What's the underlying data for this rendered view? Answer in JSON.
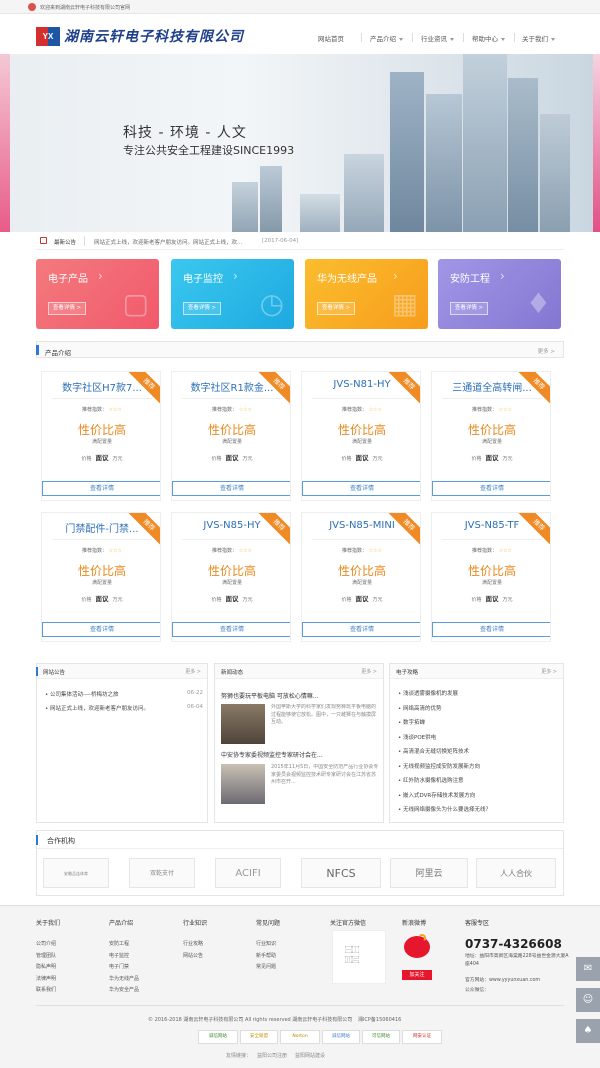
{
  "top_bar": {
    "welcome": "欢迎来到湖南云轩电子科技有限公司官网"
  },
  "logo": {
    "mark": "YX",
    "company": "湖南云轩电子科技有限公司"
  },
  "nav": [
    "网站首页",
    "产品介绍",
    "行业资讯",
    "帮助中心",
    "关于我们"
  ],
  "hero": {
    "line1": "科技 - 环境 - 人文",
    "line2": "专注公共安全工程建设SINCE1993"
  },
  "notice": {
    "label": "最新公告",
    "text": "网站正式上线，欢迎新老客户朋友访问。网站正式上线，欢...",
    "date": "[2017-06-04]"
  },
  "categories": [
    {
      "title": "电子产品",
      "button": "查看详情 >",
      "color": "#f3656e"
    },
    {
      "title": "电子监控",
      "button": "查看详情 >",
      "color": "#26b9e8"
    },
    {
      "title": "华为无线产品",
      "button": "查看详情 >",
      "color": "#f9a825"
    },
    {
      "title": "安防工程",
      "button": "查看详情 >",
      "color": "#8c7fd8"
    }
  ],
  "products_section": {
    "title": "产品介绍",
    "more": "更多 >"
  },
  "products": [
    {
      "name": "数字社区H7款7...",
      "ribbon": "推荐",
      "rec_label": "推荐指数：",
      "stars": "☆☆☆",
      "headline": "性价比高",
      "sub": "满配置量",
      "price_label": "价格",
      "price": "面议",
      "unit": "万元",
      "button": "查看详情"
    },
    {
      "name": "数字社区R1款金...",
      "ribbon": "推荐",
      "rec_label": "推荐指数：",
      "stars": "☆☆☆",
      "headline": "性价比高",
      "sub": "满配置量",
      "price_label": "价格",
      "price": "面议",
      "unit": "万元",
      "button": "查看详情"
    },
    {
      "name": "JVS-N81-HY",
      "ribbon": "推荐",
      "rec_label": "推荐指数：",
      "stars": "☆☆☆",
      "headline": "性价比高",
      "sub": "满配置量",
      "price_label": "价格",
      "price": "面议",
      "unit": "万元",
      "button": "查看详情"
    },
    {
      "name": "三通道全高转闸...",
      "ribbon": "推荐",
      "rec_label": "推荐指数：",
      "stars": "☆☆☆",
      "headline": "性价比高",
      "sub": "满配置量",
      "price_label": "价格",
      "price": "面议",
      "unit": "万元",
      "button": "查看详情"
    },
    {
      "name": "门禁配件-门禁...",
      "ribbon": "推荐",
      "rec_label": "推荐指数：",
      "stars": "☆☆☆",
      "headline": "性价比高",
      "sub": "满配置量",
      "price_label": "价格",
      "price": "面议",
      "unit": "万元",
      "button": "查看详情"
    },
    {
      "name": "JVS-N85-HY",
      "ribbon": "推荐",
      "rec_label": "推荐指数：",
      "stars": "☆☆☆",
      "headline": "性价比高",
      "sub": "满配置量",
      "price_label": "价格",
      "price": "面议",
      "unit": "万元",
      "button": "查看详情"
    },
    {
      "name": "JVS-N85-MINI",
      "ribbon": "推荐",
      "rec_label": "推荐指数：",
      "stars": "☆☆☆",
      "headline": "性价比高",
      "sub": "满配置量",
      "price_label": "价格",
      "price": "面议",
      "unit": "万元",
      "button": "查看详情"
    },
    {
      "name": "JVS-N85-TF",
      "ribbon": "推荐",
      "rec_label": "推荐指数：",
      "stars": "☆☆☆",
      "headline": "性价比高",
      "sub": "满配置量",
      "price_label": "价格",
      "price": "面议",
      "unit": "万元",
      "button": "查看详情"
    }
  ],
  "announcements": {
    "title": "网站公告",
    "more": "更多 >",
    "items": [
      {
        "text": "公司集体活动----桥梅坊之旅",
        "date": "06-22"
      },
      {
        "text": "网站正式上线，欢迎新老客户朋友访问。",
        "date": "06-04"
      }
    ]
  },
  "news": {
    "title": "新闻动态",
    "more": "更多 >",
    "items": [
      {
        "title": "努狮也要玩平板电脑 可放松心情嘛...",
        "body": "外国苹斯大学的科学家们发现努狮玩平板电脑的过程能够使它放松。图中，一只雌狮在与触摸屏互动。"
      },
      {
        "title": "中安协专家委视频监控专家研讨会在...",
        "body": "2015年11月5日，中国安全防范产品行业协会专家委员会视频监控技术研专家研讨会在江苏省苏州市召开..."
      }
    ]
  },
  "guides": {
    "title": "电子攻略",
    "more": "更多 >",
    "items": [
      "浅谈透雾摄像机的发展",
      "网络高清的优势",
      "数字拓蝉",
      "浅谈POE供电",
      "高清混合无缝切换矩阵技术",
      "无线视频监控成安防发展新方向",
      "红外防水摄像机选购注意",
      "嵌入式DVR存储技术发展方向",
      "无线网络摄像头为什么要选择无线？"
    ]
  },
  "partners": {
    "title": "合作机构",
    "logos": [
      "安徽品连体育",
      "双乾支付",
      "ACIFI",
      "NFCS",
      "阿里云",
      "人人合伙"
    ]
  },
  "footer": {
    "columns": [
      {
        "title": "关于我们",
        "items": [
          "公司介绍",
          "管理团队",
          "隐私声明",
          "法律声明",
          "联系我们"
        ]
      },
      {
        "title": "产品介绍",
        "items": [
          "安防工程",
          "电子监控",
          "电子门禁",
          "华为无线产品",
          "华为安全产品"
        ]
      },
      {
        "title": "行业知识",
        "items": [
          "行业攻略",
          "网站公告"
        ]
      },
      {
        "title": "常见问题",
        "items": [
          "行业知识",
          "新手帮助",
          "常见问题"
        ]
      }
    ],
    "wechat_title": "关注官方微信",
    "weibo_title": "新浪微博",
    "weibo_button": "加关注",
    "service_title": "客服专区",
    "phone": "0737-4326608",
    "address": "地址：益阳市高新区海棠路228号益世金源大厦A座404",
    "site": "官方网站：www.yyyunxuan.com",
    "wechat_pub": "公众微信：",
    "copyright": "© 2016-2018 湖南云轩电子科技有限公司 All rights reserved 湖南云轩电子科技有限公司",
    "icp": "湘ICP备15060416",
    "badges": [
      "诚信网站",
      "安全联盟",
      "Norton",
      "诚信网站",
      "可信网站",
      "网安认证"
    ],
    "links_label": "友情链接：",
    "links": [
      "益阳公司注册",
      "益阳网站建设"
    ]
  }
}
